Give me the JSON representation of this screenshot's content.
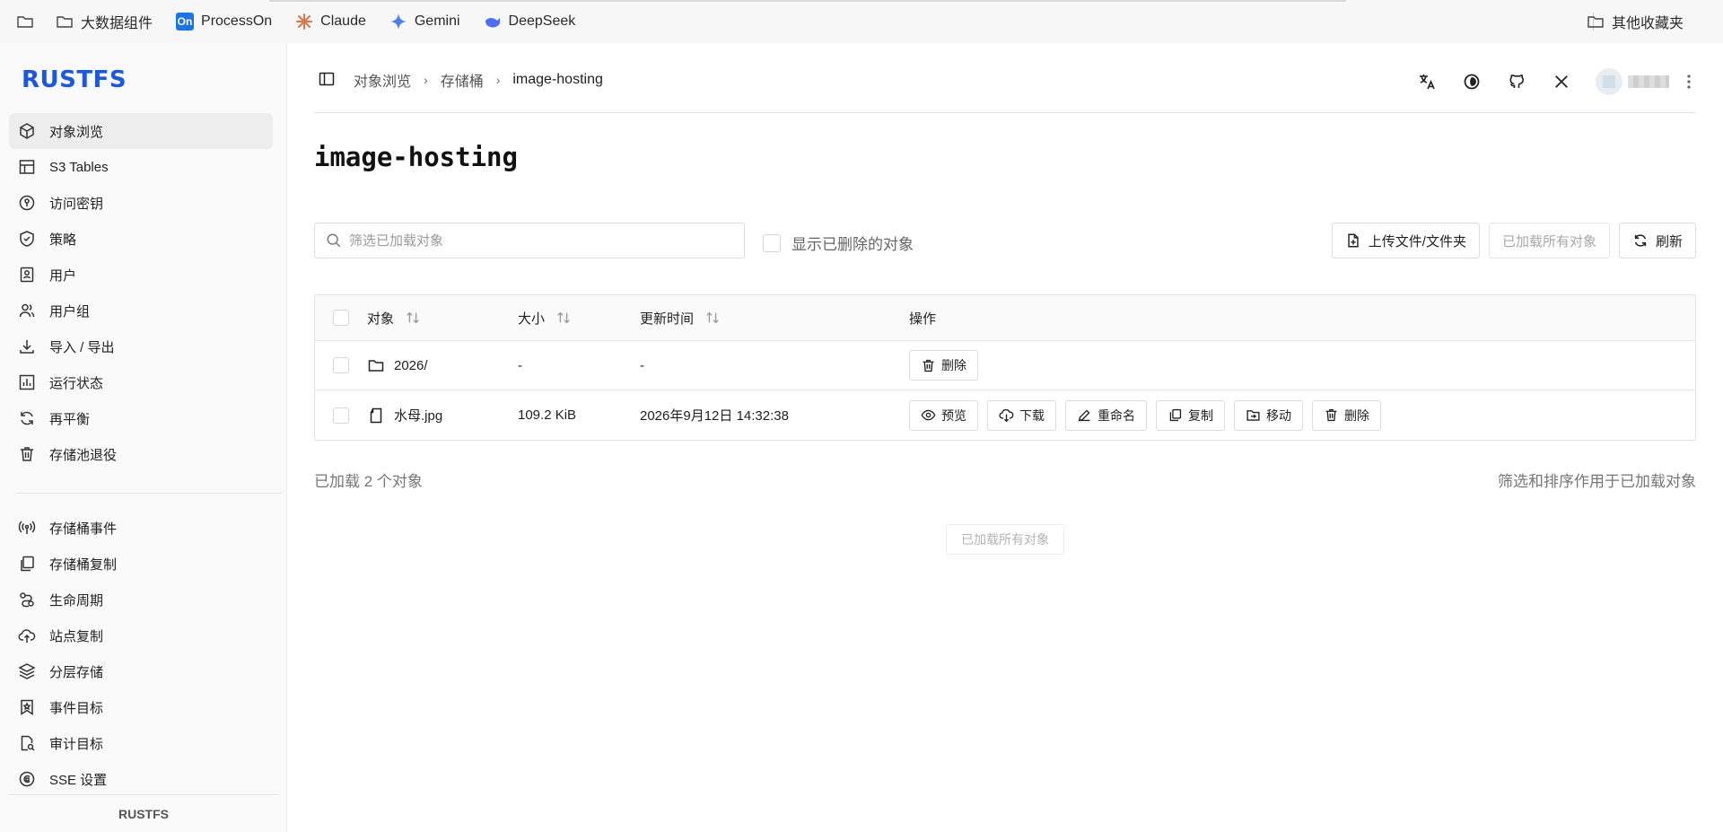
{
  "bookmarks": {
    "items": [
      {
        "label": "大数据组件",
        "icon": "folder-icon"
      },
      {
        "label": "ProcessOn",
        "icon": "processon-icon",
        "badge": "On"
      },
      {
        "label": "Claude",
        "icon": "claude-icon"
      },
      {
        "label": "Gemini",
        "icon": "gemini-icon"
      },
      {
        "label": "DeepSeek",
        "icon": "deepseek-icon"
      }
    ],
    "other": "其他收藏夹"
  },
  "sidebar": {
    "logo": "RUSTFS",
    "primary": [
      {
        "label": "对象浏览",
        "icon": "cube-icon",
        "active": true
      },
      {
        "label": "S3 Tables",
        "icon": "table-icon"
      },
      {
        "label": "访问密钥",
        "icon": "key-icon"
      },
      {
        "label": "策略",
        "icon": "shield-check-icon"
      },
      {
        "label": "用户",
        "icon": "user-badge-icon"
      },
      {
        "label": "用户组",
        "icon": "users-icon"
      },
      {
        "label": "导入 / 导出",
        "icon": "download-icon"
      },
      {
        "label": "运行状态",
        "icon": "chart-icon"
      },
      {
        "label": "再平衡",
        "icon": "refresh-icon"
      },
      {
        "label": "存储池退役",
        "icon": "trash-icon"
      }
    ],
    "secondary": [
      {
        "label": "存储桶事件",
        "icon": "broadcast-icon"
      },
      {
        "label": "存储桶复制",
        "icon": "copy-icon"
      },
      {
        "label": "生命周期",
        "icon": "lifecycle-icon"
      },
      {
        "label": "站点复制",
        "icon": "cloud-upload-icon"
      },
      {
        "label": "分层存储",
        "icon": "layers-icon"
      },
      {
        "label": "事件目标",
        "icon": "bookmark-star-icon"
      },
      {
        "label": "审计目标",
        "icon": "audit-icon"
      },
      {
        "label": "SSE 设置",
        "icon": "encryption-icon"
      }
    ],
    "footer": "RUSTFS"
  },
  "header": {
    "breadcrumb": [
      "对象浏览",
      "存储桶",
      "image-hosting"
    ]
  },
  "main": {
    "title": "image-hosting",
    "search_placeholder": "筛选已加载对象",
    "show_deleted_label": "显示已删除的对象",
    "upload_label": "上传文件/文件夹",
    "load_all_label": "已加载所有对象",
    "refresh_label": "刷新",
    "columns": {
      "object": "对象",
      "size": "大小",
      "updated": "更新时间",
      "actions": "操作"
    },
    "rows": [
      {
        "name": "2026/",
        "type": "folder",
        "size": "-",
        "updated": "-",
        "actions": [
          "删除"
        ]
      },
      {
        "name": "水母.jpg",
        "type": "file",
        "size": "109.2 KiB",
        "updated": "2026年9月12日 14:32:38",
        "actions": [
          "预览",
          "下载",
          "重命名",
          "复制",
          "移动",
          "删除"
        ]
      }
    ],
    "loaded_count": "已加载 2 个对象",
    "filter_note": "筛选和排序作用于已加载对象",
    "all_loaded": "已加载所有对象"
  },
  "colors": {
    "brand": "#1a57e6",
    "active_bg": "#ededed",
    "border": "#e3e3e3"
  }
}
